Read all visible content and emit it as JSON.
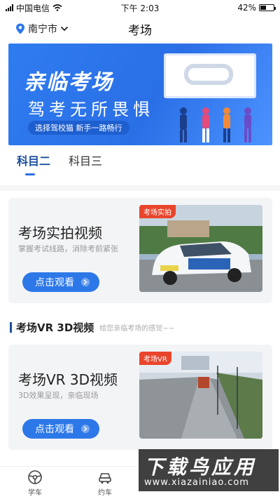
{
  "status_bar": {
    "carrier": "中国电信",
    "time": "下午 2:03",
    "battery": "42%",
    "battery_level": 0.42
  },
  "nav": {
    "city": "南宁市",
    "title": "考场"
  },
  "banner": {
    "headline": "亲临考场",
    "subheadline": "驾考无所畏惧",
    "tagline": "选择驾校猫  新手一路畅行"
  },
  "tabs": [
    {
      "label": "科目二",
      "active": true
    },
    {
      "label": "科目三",
      "active": false
    }
  ],
  "cards": [
    {
      "title": "考场实拍视频",
      "desc": "掌握考试线路，消除考前紧张",
      "button": "点击观看",
      "tag": "考场实拍"
    },
    {
      "title": "考场VR 3D视频",
      "desc": "3D效果呈现，亲临现场",
      "button": "点击观看",
      "tag": "考场VR"
    }
  ],
  "section": {
    "title": "考场VR 3D视频",
    "subtitle": "给您亲临考场的感觉~~"
  },
  "bottom_nav": [
    {
      "label": "学车",
      "icon": "steering-wheel-icon"
    },
    {
      "label": "约车",
      "icon": "car-icon"
    },
    {
      "label": "",
      "icon": ""
    },
    {
      "label": "",
      "icon": ""
    }
  ],
  "watermark": {
    "big": "下载鸟应用",
    "small": "www.xiazainiao.com"
  },
  "colors": {
    "accent": "#2d78e8",
    "tab_active": "#1c4fa0",
    "tag": "#e8452c"
  }
}
